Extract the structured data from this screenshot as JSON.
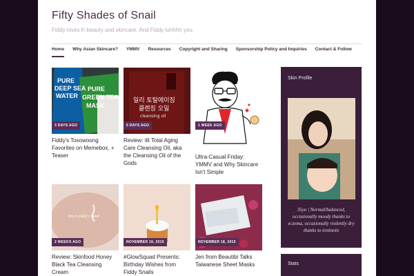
{
  "site": {
    "title": "Fifty Shades of Snail",
    "tagline": "Fiddy loves K-beauty and skincare. And Fiddy luhhhh you."
  },
  "nav": {
    "items": [
      {
        "label": "Home",
        "active": true
      },
      {
        "label": "Why Asian Skincare?"
      },
      {
        "label": "YMMV"
      },
      {
        "label": "Resources"
      },
      {
        "label": "Copyright and Sharing"
      },
      {
        "label": "Sponsorship Policy and Inquiries"
      },
      {
        "label": "Contact & Follow"
      }
    ]
  },
  "posts": [
    {
      "badge": "3 days ago",
      "title": "Fiddy's Tosowoong Favorites on Memebox, + Teaser",
      "thumb_text": [
        "PURE",
        "DEEP SEA",
        "WATER",
        "PURE",
        "GREEN TEA",
        "MASK"
      ]
    },
    {
      "badge": "6 days ago",
      "title": "Review: illi Total Aging Care Cleansing Oil, aka the Cleansing Oil of the Gods",
      "thumb_text": [
        "일리 토탈에이징",
        "클렌징 오일",
        "cleansing oil"
      ]
    },
    {
      "badge": "1 week ago",
      "title": "Ultra-Casual Friday: YMMV and Why Skincare Isn't Simple"
    },
    {
      "badge": "2 weeks ago",
      "title": "Review: Skinfood Honey Black Tea Cleansing Cream",
      "thumb_text": [
        "this is fiddy's hand"
      ]
    },
    {
      "badge": "November 19, 2015",
      "title": "#GlowSquad Presents: Birthday Wishes from Fiddy Snails"
    },
    {
      "badge": "November 18, 2015",
      "title": "Jen from Beautibi Talks Taiwanese Sheet Masks"
    }
  ],
  "sidebar": {
    "profile_heading": "Skin Profile",
    "profile_caption": "35yo | Normal/balanced, occasionally moody thanks to eczema, occasionally violently dry thanks to tretinoin",
    "stats_heading": "Stats"
  },
  "colors": {
    "accent": "#5a2d57",
    "sidebar_bg": "#3b1e3a",
    "outer_bg": "#1a0c1c"
  }
}
